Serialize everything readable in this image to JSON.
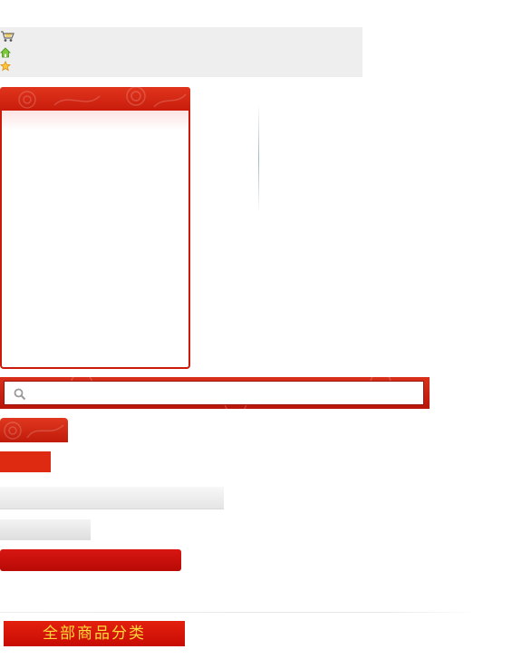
{
  "top_strip": {
    "icons": [
      "cart-icon",
      "home-icon",
      "star-icon"
    ]
  },
  "panel": {
    "title": ""
  },
  "search": {
    "placeholder": "",
    "icon": "search-icon"
  },
  "category_button": {
    "label": "全部商品分类"
  },
  "colors": {
    "brand_red": "#cc1a0a",
    "accent_yellow": "#ffd93a",
    "strip_gray": "#eeeeee"
  }
}
